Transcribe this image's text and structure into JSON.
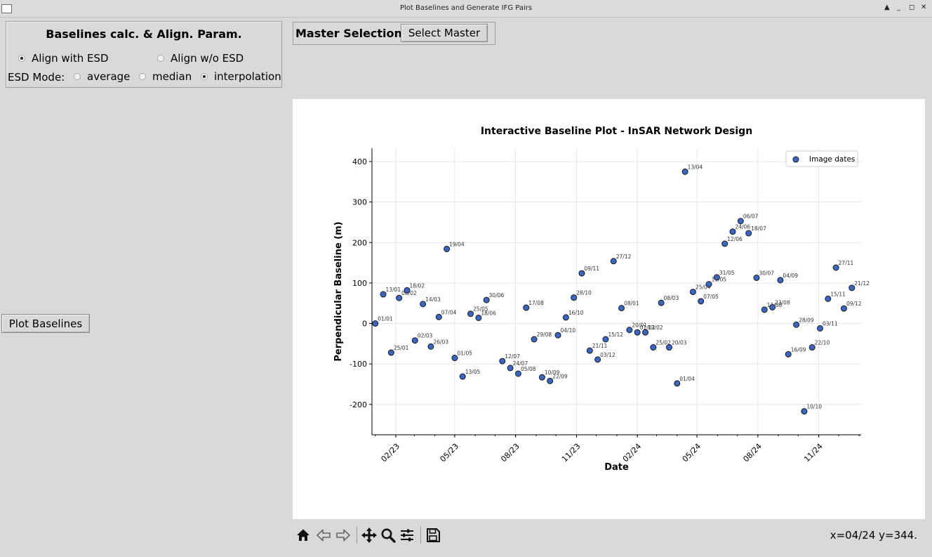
{
  "window": {
    "title": "Plot Baselines and Generate IFG Pairs",
    "controls": [
      "▲",
      "_",
      "◻",
      "✕"
    ]
  },
  "align_panel": {
    "title": "Baselines calc. & Align. Param.",
    "align_esd": "Align with ESD",
    "align_wo_esd": "Align w/o ESD",
    "selected_alignment": "Align with ESD",
    "esd_mode_label": "ESD Mode:",
    "modes": [
      "average",
      "median",
      "interpolation"
    ],
    "selected_mode": "interpolation"
  },
  "master_panel": {
    "title": "Master Selection",
    "button": "Select Master"
  },
  "plot_button": "Plot Baselines",
  "toolbar": {
    "icons": [
      "home-icon",
      "back-arrow-icon",
      "forward-arrow-icon",
      "pan-icon",
      "zoom-icon",
      "configure-subplots-icon",
      "save-icon"
    ],
    "coordinates": "x=04/24 y=344."
  },
  "chart_data": {
    "type": "scatter",
    "title": "Interactive Baseline Plot - InSAR Network Design",
    "xlabel": "Date",
    "ylabel": "Perpendicular Baseline (m)",
    "x_tick_labels": [
      "02/23",
      "05/23",
      "08/23",
      "11/23",
      "02/24",
      "05/24",
      "08/24",
      "11/24"
    ],
    "x_ticks": [
      "2023-02-01",
      "2023-05-01",
      "2023-08-01",
      "2023-11-01",
      "2024-02-01",
      "2024-05-01",
      "2024-08-01",
      "2024-11-01"
    ],
    "xlim": [
      "2022-12-27",
      "2025-01-04"
    ],
    "y_ticks": [
      -200,
      -100,
      0,
      100,
      200,
      300,
      400
    ],
    "ylim": [
      -275,
      433
    ],
    "grid": true,
    "legend": {
      "label": "Image dates",
      "position": "top-right"
    },
    "marker_color": "#3a66c4",
    "points": [
      {
        "x": "2023-01-01",
        "y": 0,
        "label": "01/01"
      },
      {
        "x": "2023-01-13",
        "y": 72,
        "label": "13/01"
      },
      {
        "x": "2023-01-25",
        "y": -72,
        "label": "25/01"
      },
      {
        "x": "2023-02-06",
        "y": 63,
        "label": "06/02"
      },
      {
        "x": "2023-02-18",
        "y": 82,
        "label": "18/02"
      },
      {
        "x": "2023-03-02",
        "y": -42,
        "label": "02/03"
      },
      {
        "x": "2023-03-14",
        "y": 48,
        "label": "14/03"
      },
      {
        "x": "2023-03-26",
        "y": -57,
        "label": "26/03"
      },
      {
        "x": "2023-04-07",
        "y": 16,
        "label": "07/04"
      },
      {
        "x": "2023-04-19",
        "y": 184,
        "label": "19/04"
      },
      {
        "x": "2023-05-01",
        "y": -85,
        "label": "01/05"
      },
      {
        "x": "2023-05-13",
        "y": -131,
        "label": "13/05"
      },
      {
        "x": "2023-05-25",
        "y": 24,
        "label": "25/05"
      },
      {
        "x": "2023-06-06",
        "y": 14,
        "label": "18/06"
      },
      {
        "x": "2023-06-18",
        "y": 58,
        "label": "30/06"
      },
      {
        "x": "2023-07-12",
        "y": -93,
        "label": "12/07"
      },
      {
        "x": "2023-07-24",
        "y": -110,
        "label": "24/07"
      },
      {
        "x": "2023-08-05",
        "y": -124,
        "label": "05/08"
      },
      {
        "x": "2023-08-17",
        "y": 39,
        "label": "17/08"
      },
      {
        "x": "2023-08-29",
        "y": -39,
        "label": "29/08"
      },
      {
        "x": "2023-09-10",
        "y": -133,
        "label": "10/09"
      },
      {
        "x": "2023-09-22",
        "y": -142,
        "label": "22/09"
      },
      {
        "x": "2023-10-04",
        "y": -29,
        "label": "04/10"
      },
      {
        "x": "2023-10-16",
        "y": 15,
        "label": "16/10"
      },
      {
        "x": "2023-10-28",
        "y": 64,
        "label": "28/10"
      },
      {
        "x": "2023-11-09",
        "y": 124,
        "label": "09/11"
      },
      {
        "x": "2023-11-21",
        "y": -67,
        "label": "21/11"
      },
      {
        "x": "2023-12-03",
        "y": -89,
        "label": "03/12"
      },
      {
        "x": "2023-12-15",
        "y": -39,
        "label": "15/12"
      },
      {
        "x": "2023-12-27",
        "y": 154,
        "label": "27/12"
      },
      {
        "x": "2024-01-08",
        "y": 38,
        "label": "08/01"
      },
      {
        "x": "2024-01-20",
        "y": -16,
        "label": "20/01"
      },
      {
        "x": "2024-02-01",
        "y": -22,
        "label": "01/02"
      },
      {
        "x": "2024-02-13",
        "y": -22,
        "label": "13/02"
      },
      {
        "x": "2024-02-25",
        "y": -59,
        "label": "25/02"
      },
      {
        "x": "2024-03-08",
        "y": 51,
        "label": "08/03"
      },
      {
        "x": "2024-03-20",
        "y": -59,
        "label": "20/03"
      },
      {
        "x": "2024-04-01",
        "y": -148,
        "label": "01/04"
      },
      {
        "x": "2024-04-13",
        "y": 375,
        "label": "13/04"
      },
      {
        "x": "2024-04-25",
        "y": 78,
        "label": "25/04"
      },
      {
        "x": "2024-05-07",
        "y": 55,
        "label": "07/05"
      },
      {
        "x": "2024-05-19",
        "y": 97,
        "label": "19/05"
      },
      {
        "x": "2024-05-31",
        "y": 114,
        "label": "31/05"
      },
      {
        "x": "2024-06-12",
        "y": 197,
        "label": "12/06"
      },
      {
        "x": "2024-06-24",
        "y": 227,
        "label": "24/06"
      },
      {
        "x": "2024-07-06",
        "y": 253,
        "label": "06/07"
      },
      {
        "x": "2024-07-18",
        "y": 223,
        "label": "18/07"
      },
      {
        "x": "2024-07-30",
        "y": 113,
        "label": "30/07"
      },
      {
        "x": "2024-08-11",
        "y": 34,
        "label": "11/08"
      },
      {
        "x": "2024-08-23",
        "y": 40,
        "label": "23/08"
      },
      {
        "x": "2024-09-04",
        "y": 107,
        "label": "04/09"
      },
      {
        "x": "2024-09-16",
        "y": -76,
        "label": "16/09"
      },
      {
        "x": "2024-09-28",
        "y": -3,
        "label": "28/09"
      },
      {
        "x": "2024-10-10",
        "y": -217,
        "label": "10/10"
      },
      {
        "x": "2024-10-22",
        "y": -59,
        "label": "22/10"
      },
      {
        "x": "2024-11-03",
        "y": -12,
        "label": "03/11"
      },
      {
        "x": "2024-11-15",
        "y": 61,
        "label": "15/11"
      },
      {
        "x": "2024-11-27",
        "y": 138,
        "label": "27/11"
      },
      {
        "x": "2024-12-09",
        "y": 37,
        "label": "09/12"
      },
      {
        "x": "2024-12-21",
        "y": 88,
        "label": "21/12"
      }
    ]
  }
}
